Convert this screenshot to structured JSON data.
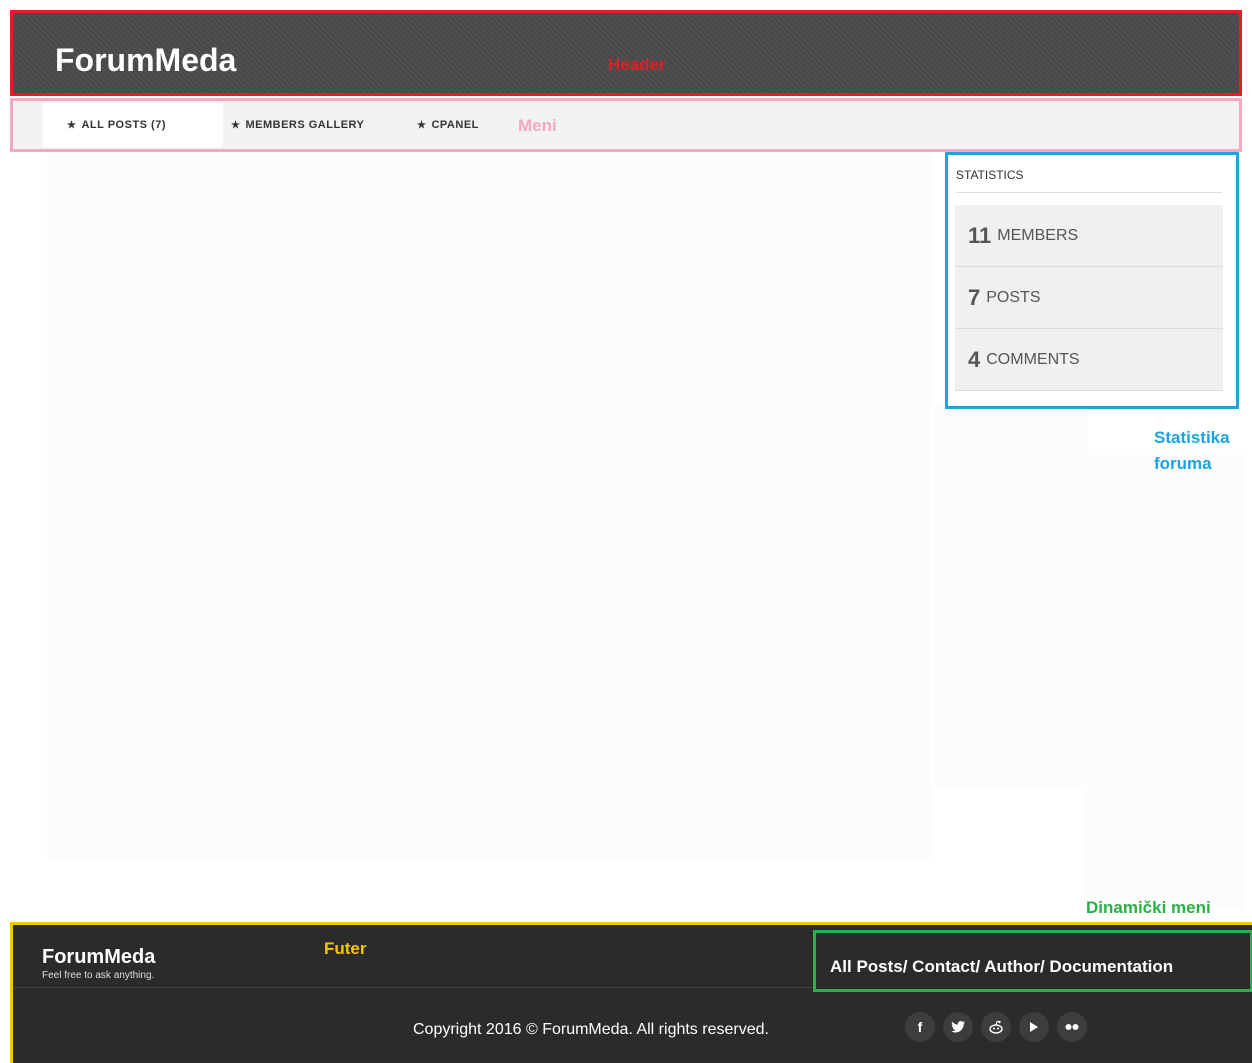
{
  "header": {
    "brand": "ForumMeda",
    "annotation": "Header"
  },
  "menu": {
    "items": [
      {
        "label": "ALL POSTS (7)",
        "active": true
      },
      {
        "label": "MEMBERS GALLERY",
        "active": false
      },
      {
        "label": "CPANEL",
        "active": false
      }
    ],
    "star": "★",
    "annotation": "Meni"
  },
  "statistics": {
    "title": "STATISTICS",
    "rows": [
      {
        "count": "11",
        "label": "MEMBERS"
      },
      {
        "count": "7",
        "label": "POSTS"
      },
      {
        "count": "4",
        "label": "COMMENTS"
      }
    ],
    "annotation_line1": "Statistika",
    "annotation_line2": "foruma"
  },
  "footer": {
    "brand": "ForumMeda",
    "tagline": "Feel free to ask anything.",
    "annotation": "Futer",
    "dynamic_menu_annotation": "Dinamički meni",
    "dynamic_links": "All Posts/ Contact/ Author/ Documentation",
    "copyright": "Copyright 2016 © ForumMeda. All rights reserved.",
    "social_icons": [
      "facebook-icon",
      "twitter-icon",
      "reddit-icon",
      "youtube-icon",
      "flickr-icon"
    ]
  },
  "colors": {
    "header_bg": "#4a4a4a",
    "header_annotation": "#e21e26",
    "menu_annotation": "#f4a9c3",
    "stats_annotation": "#1ba4e1",
    "footer_annotation": "#f5c500",
    "dynamic_menu_annotation": "#2db04a",
    "footer_bg": "#2b2b2b"
  }
}
